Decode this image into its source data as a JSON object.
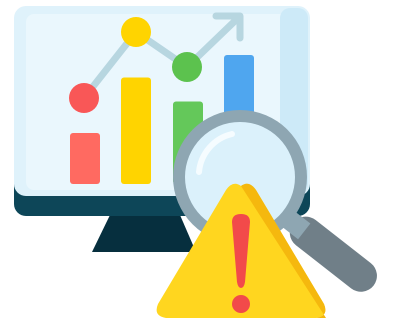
{
  "illustration": {
    "subject": "chart-analysis-warning",
    "chart": {
      "bar_levels": [
        0.34,
        0.71,
        0.55,
        0.86
      ],
      "trend_points": 4
    },
    "colors": {
      "monitor_frame": "#dff2fb",
      "monitor_screen": "#eaf7fd",
      "monitor_highlight": "#cdeaf8",
      "monitor_base": "#0d4658",
      "monitor_stand": "#062f3e",
      "bar_red": "#ff6a61",
      "bar_yellow": "#ffd400",
      "bar_green": "#64c85a",
      "bar_blue": "#4fa6ef",
      "trend_line": "#b7d6e0",
      "point_red": "#f95757",
      "point_yellow": "#ffd400",
      "point_green": "#5cc24e",
      "magnifier_ring": "#8ea6b2",
      "magnifier_lens": "#dbf1fb",
      "magnifier_handle": "#707f88",
      "warning_fill": "#ffd61f",
      "warning_shade": "#f5b80e",
      "warning_mark": "#f24a4a"
    }
  }
}
